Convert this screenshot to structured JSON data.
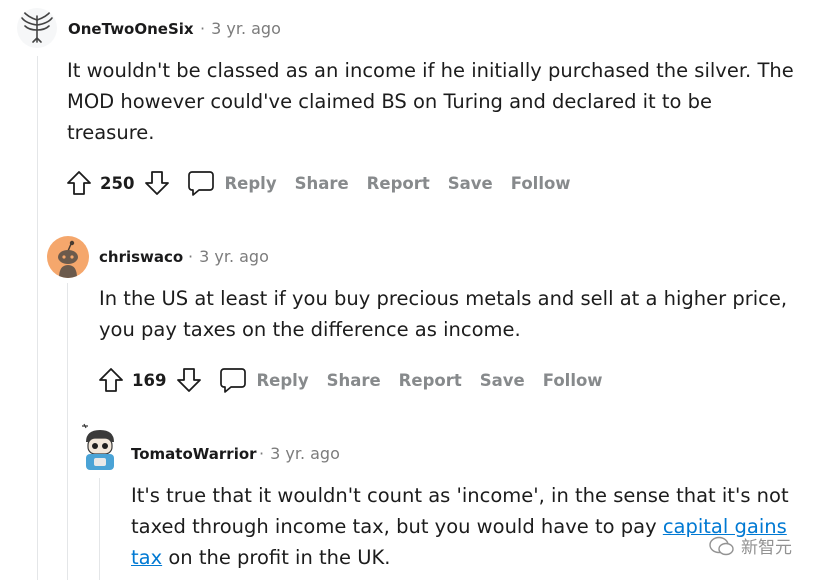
{
  "comments": [
    {
      "author": "OneTwoOneSix",
      "time": "3 yr. ago",
      "separator": "·",
      "lines": [
        "It wouldn't be classed as an income if he initially purchased the silver. The",
        "MOD however could've claimed BS on Turing and declared it to be",
        "treasure."
      ],
      "score": "250",
      "actions": [
        "Reply",
        "Share",
        "Report",
        "Save",
        "Follow"
      ]
    },
    {
      "author": "chriswaco",
      "time": "3 yr. ago",
      "separator": "·",
      "lines": [
        "In the US at least if you buy precious metals and sell at a higher price,",
        "you pay taxes on the difference as income."
      ],
      "score": "169",
      "actions": [
        "Reply",
        "Share",
        "Report",
        "Save",
        "Follow"
      ]
    },
    {
      "author": "TomatoWarrior",
      "time": "3 yr. ago",
      "separator": "·",
      "line1": "It's true that it wouldn't count as 'income', in the sense that it's not",
      "line2_prefix": "taxed through income tax, but you would have to pay ",
      "link_part1": "capital gains",
      "link_part2": "tax",
      "line3_suffix": " on the profit in the UK."
    }
  ],
  "watermark": "新智元",
  "colors": {
    "link": "#0079d3",
    "action_gray": "#878a8c",
    "thread_line": "#e4e6e8",
    "avatar_orange": "#f5a76c"
  }
}
